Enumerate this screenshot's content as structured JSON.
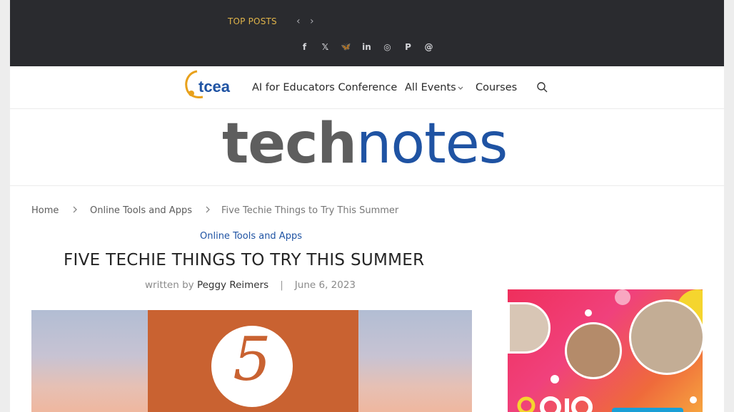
{
  "topbar": {
    "label": "TOP POSTS",
    "prev": "‹",
    "next": "›",
    "social": [
      {
        "icon": "facebook-icon",
        "glyph": "f"
      },
      {
        "icon": "x-icon",
        "glyph": "𝕏"
      },
      {
        "icon": "bluesky-icon",
        "glyph": "🦋"
      },
      {
        "icon": "linkedin-icon",
        "glyph": "in"
      },
      {
        "icon": "instagram-icon",
        "glyph": "◎"
      },
      {
        "icon": "pinterest-icon",
        "glyph": "P"
      },
      {
        "icon": "threads-icon",
        "glyph": "@"
      }
    ]
  },
  "nav": {
    "logo_text": "tcea",
    "items": [
      {
        "label": "AI for Educators Conference"
      },
      {
        "label": "All Events"
      },
      {
        "label": "Courses"
      }
    ]
  },
  "masthead": {
    "tech": "tech",
    "notes": "notes"
  },
  "breadcrumb": [
    "Home",
    "Online Tools and Apps",
    "Five Techie Things to Try This Summer"
  ],
  "article": {
    "category": "Online Tools and Apps",
    "title": "FIVE TECHIE THINGS TO TRY THIS SUMMER",
    "written_by": "written by",
    "author": "Peggy Reimers",
    "date": "June 6, 2023",
    "hero_number": "5"
  },
  "colors": {
    "topbar_bg": "#2a2b2f",
    "accent_gold": "#e0b44a",
    "brand_blue": "#1f53a3",
    "hero_orange": "#c96231"
  }
}
